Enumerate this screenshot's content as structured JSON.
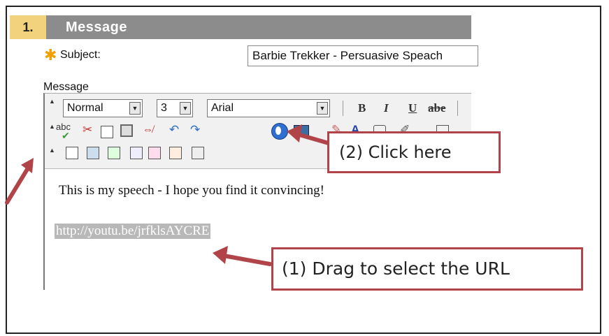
{
  "step": {
    "number": "1.",
    "title": "Message"
  },
  "subject": {
    "label": "Subject:",
    "value": "Barbie Trekker - Persuasive Speach"
  },
  "message_label": "Message",
  "toolbar": {
    "format_select": "Normal",
    "size_select": "3",
    "font_select": "Arial",
    "bold": "B",
    "italic": "I",
    "underline": "U",
    "strikethrough": "abe",
    "spellcheck": "abc"
  },
  "content": {
    "line1": "This is my speech - I hope you find it convincing!",
    "url": "http://youtu.be/jrfklsAYCRE"
  },
  "callouts": {
    "click_here": "(2) Click here",
    "drag_select": "(1) Drag to select the URL"
  },
  "colors": {
    "header_bar": "#8c8c8c",
    "step_badge": "#f2d27c",
    "callout_border": "#b14448",
    "required_star": "#f0a000"
  }
}
